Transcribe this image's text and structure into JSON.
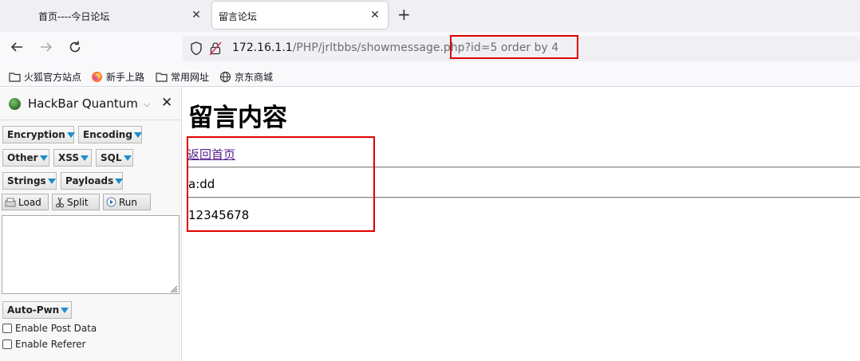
{
  "tabs": [
    {
      "label": "首页----今日论坛",
      "active": false
    },
    {
      "label": "留言论坛",
      "active": true
    }
  ],
  "address": {
    "host": "172.16.1.1",
    "path": "/PHP/jrltbbs/showmessage.php",
    "query": "?id=5 order by 4"
  },
  "bookmarks": [
    {
      "label": "火狐官方站点",
      "icon": "folder-icon"
    },
    {
      "label": "新手上路",
      "icon": "firefox-icon"
    },
    {
      "label": "常用网址",
      "icon": "folder-icon"
    },
    {
      "label": "京东商城",
      "icon": "globe-icon"
    }
  ],
  "hackbar": {
    "title": "HackBar Quantum",
    "menus": [
      "Encryption",
      "Encoding",
      "Other",
      "XSS",
      "SQL",
      "Strings",
      "Payloads"
    ],
    "actions": [
      "Load",
      "Split",
      "Run"
    ],
    "textarea_value": "",
    "autopwn": "Auto-Pwn",
    "options": [
      "Enable Post Data",
      "Enable Referer"
    ]
  },
  "page": {
    "title": "留言内容",
    "back_link": "返回首页",
    "author_line": "a:dd",
    "content_line": "12345678"
  },
  "colors": {
    "highlight": "#e00000",
    "visited_link": "#551a8b",
    "menu_arrow": "#1c8fc9"
  }
}
